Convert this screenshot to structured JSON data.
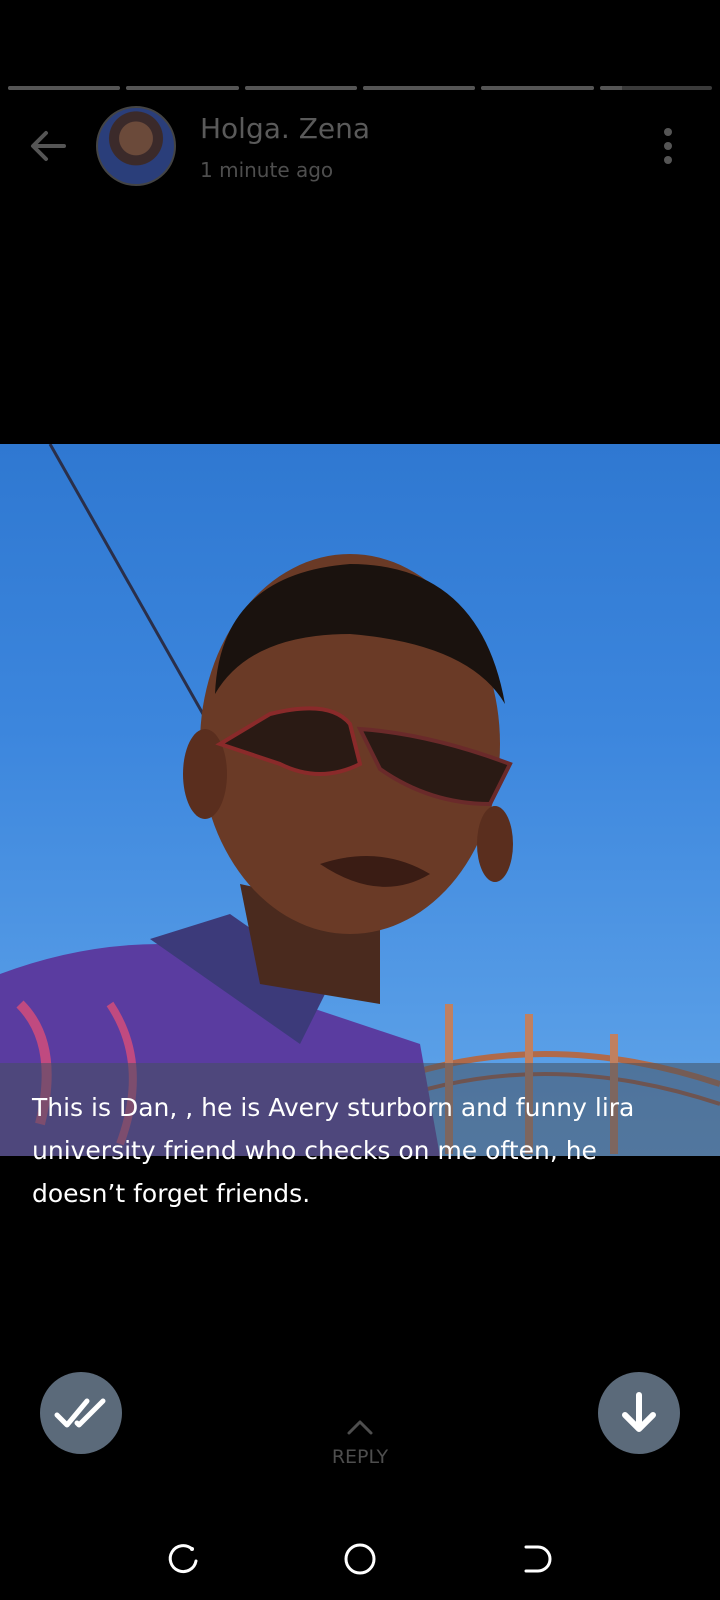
{
  "status": {
    "segments": 6,
    "viewed_segments": 5,
    "current_progress": 0.2
  },
  "header": {
    "contact_name": "Holga. Zena",
    "timestamp": "1 minute ago",
    "back_icon": "arrow-left-icon",
    "menu_icon": "more-vertical-icon"
  },
  "story": {
    "caption": "This is Dan, , he is Avery sturborn and funny lira university friend who  checks on me often, he doesn’t forget friends."
  },
  "actions": {
    "seen_icon": "double-check-icon",
    "download_icon": "arrow-down-icon",
    "reply_label": "REPLY",
    "reply_icon": "chevron-up-icon"
  },
  "navbar": {
    "recents_icon": "recents-icon",
    "home_icon": "home-icon",
    "back_icon": "nav-back-icon"
  },
  "colors": {
    "background": "#000000",
    "action_button": "#5b6a7a",
    "muted_text": "#5a5a5a"
  }
}
